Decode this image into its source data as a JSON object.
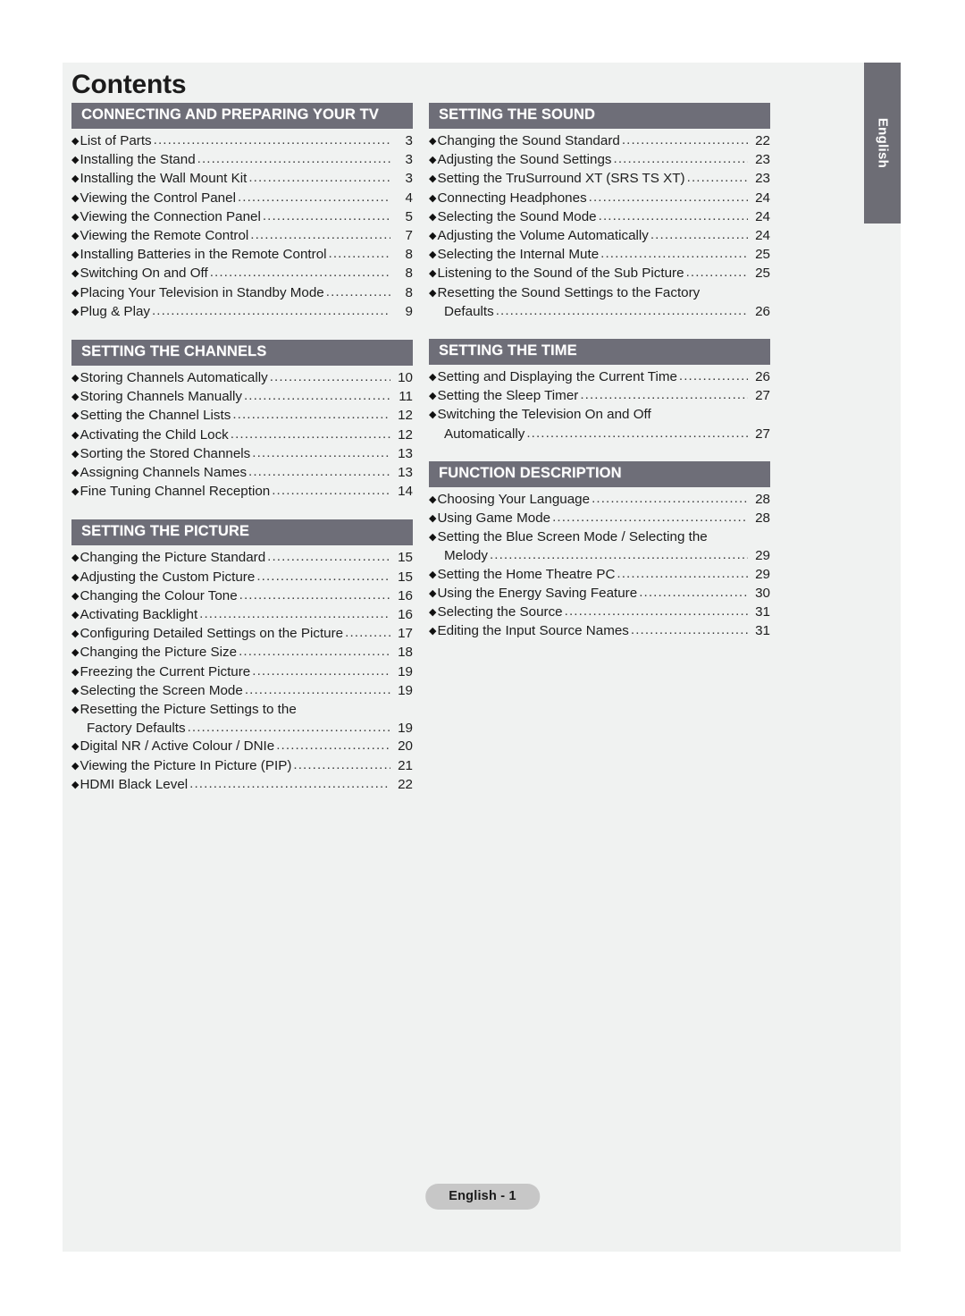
{
  "page": {
    "title": "Contents",
    "side_tab_label": "English",
    "footer_badge": "English - 1",
    "accent_header_color": "#6e6e78",
    "sheet_color": "#f0f2f1",
    "badge_color": "#c7c7c7",
    "bullet_glyph": "◆",
    "leader_char": "."
  },
  "columns": {
    "left": [
      {
        "header": "CONNECTING AND PREPARING YOUR TV",
        "entries": [
          {
            "text": "List of Parts",
            "page": "3"
          },
          {
            "text": "Installing the Stand",
            "page": "3"
          },
          {
            "text": "Installing the Wall Mount Kit",
            "page": "3"
          },
          {
            "text": "Viewing the Control Panel",
            "page": "4"
          },
          {
            "text": "Viewing the Connection Panel",
            "page": "5"
          },
          {
            "text": "Viewing the Remote Control",
            "page": "7"
          },
          {
            "text": "Installing Batteries in the Remote Control",
            "page": "8"
          },
          {
            "text": "Switching On and Off",
            "page": "8"
          },
          {
            "text": "Placing Your Television in Standby Mode",
            "page": "8"
          },
          {
            "text": "Plug & Play",
            "page": "9"
          }
        ]
      },
      {
        "header": "SETTING THE CHANNELS",
        "entries": [
          {
            "text": "Storing Channels Automatically",
            "page": "10"
          },
          {
            "text": "Storing Channels Manually",
            "page": "11"
          },
          {
            "text": "Setting the Channel Lists",
            "page": "12"
          },
          {
            "text": "Activating the Child Lock",
            "page": "12"
          },
          {
            "text": "Sorting the Stored Channels",
            "page": "13"
          },
          {
            "text": "Assigning Channels Names",
            "page": "13"
          },
          {
            "text": "Fine Tuning Channel Reception",
            "page": "14"
          }
        ]
      },
      {
        "header": "SETTING THE PICTURE",
        "entries": [
          {
            "text": "Changing the Picture Standard",
            "page": "15"
          },
          {
            "text": "Adjusting the Custom Picture",
            "page": "15"
          },
          {
            "text": "Changing the Colour Tone",
            "page": "16"
          },
          {
            "text": "Activating Backlight",
            "page": "16"
          },
          {
            "text": "Configuring Detailed Settings on the Picture",
            "page": "17"
          },
          {
            "text": "Changing the Picture Size",
            "page": "18"
          },
          {
            "text": "Freezing the Current Picture",
            "page": "19"
          },
          {
            "text": "Selecting the Screen Mode",
            "page": "19"
          },
          {
            "text": "Resetting the Picture Settings to the",
            "page": "",
            "no_leader": true
          },
          {
            "text": "Factory Defaults",
            "page": "19",
            "continuation": true
          },
          {
            "text": "Digital NR / Active Colour / DNIe",
            "page": "20"
          },
          {
            "text": "Viewing the Picture In Picture (PIP)",
            "page": "21"
          },
          {
            "text": "HDMI Black Level",
            "page": "22"
          }
        ]
      }
    ],
    "right": [
      {
        "header": "SETTING THE SOUND",
        "entries": [
          {
            "text": "Changing the Sound Standard",
            "page": "22"
          },
          {
            "text": "Adjusting the Sound Settings",
            "page": "23"
          },
          {
            "text": "Setting the TruSurround XT (SRS TS XT)",
            "page": "23"
          },
          {
            "text": "Connecting Headphones",
            "page": "24"
          },
          {
            "text": "Selecting the Sound Mode",
            "page": "24"
          },
          {
            "text": "Adjusting the Volume Automatically",
            "page": "24"
          },
          {
            "text": "Selecting the Internal Mute",
            "page": "25"
          },
          {
            "text": "Listening to the Sound of the Sub Picture",
            "page": "25"
          },
          {
            "text": "Resetting the Sound Settings to the Factory",
            "page": "",
            "no_leader": true
          },
          {
            "text": "Defaults",
            "page": "26",
            "continuation": true
          }
        ]
      },
      {
        "header": "SETTING THE TIME",
        "entries": [
          {
            "text": "Setting and Displaying the Current Time",
            "page": "26"
          },
          {
            "text": "Setting the Sleep Timer",
            "page": "27"
          },
          {
            "text": "Switching the Television On and Off",
            "page": "",
            "no_leader": true
          },
          {
            "text": "Automatically",
            "page": "27",
            "continuation": true
          }
        ]
      },
      {
        "header": "FUNCTION DESCRIPTION",
        "entries": [
          {
            "text": "Choosing Your Language",
            "page": "28"
          },
          {
            "text": "Using Game Mode",
            "page": "28"
          },
          {
            "text": "Setting the Blue Screen Mode / Selecting the",
            "page": "",
            "no_leader": true
          },
          {
            "text": "Melody",
            "page": "29",
            "continuation": true
          },
          {
            "text": "Setting the Home Theatre PC",
            "page": "29"
          },
          {
            "text": "Using the Energy Saving Feature",
            "page": "30"
          },
          {
            "text": "Selecting the Source",
            "page": "31"
          },
          {
            "text": "Editing the Input Source Names",
            "page": "31"
          }
        ]
      }
    ]
  }
}
